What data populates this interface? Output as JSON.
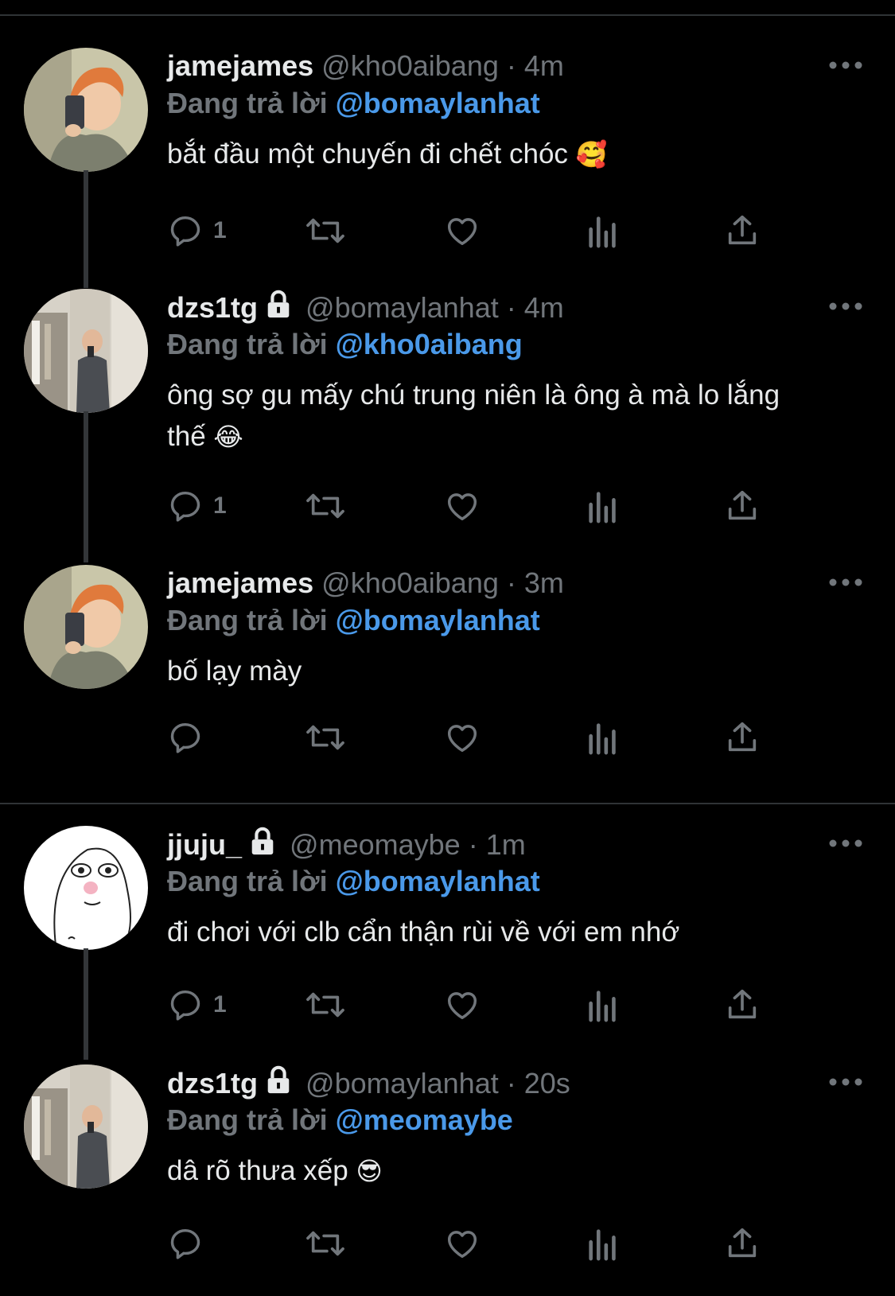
{
  "colors": {
    "background": "#000000",
    "text": "#e7e9ea",
    "muted": "#71767b",
    "mention": "#4a99e9",
    "divider": "#2f3336"
  },
  "reply_prefix": "Đang trả lời",
  "tweets": [
    {
      "name": "jamejames",
      "locked": false,
      "handle": "@kho0aibang",
      "dot": "·",
      "time": "4m",
      "reply_to": "@bomaylanhat",
      "text": "bắt đầu một chuyến đi chết chóc",
      "emoji": "🥰",
      "reply_count": "1",
      "avatar": "orange-hair-selfie"
    },
    {
      "name": "dzs1tg",
      "locked": true,
      "handle": "@bomaylanhat",
      "dot": "·",
      "time": "4m",
      "reply_to": "@kho0aibang",
      "text": "ông sợ gu mấy chú trung niên là ông à mà lo lắng thế",
      "emoji": "😂",
      "reply_count": "1",
      "avatar": "mirror-selfie"
    },
    {
      "name": "jamejames",
      "locked": false,
      "handle": "@kho0aibang",
      "dot": "·",
      "time": "3m",
      "reply_to": "@bomaylanhat",
      "text": "bố lạy mày",
      "emoji": "",
      "reply_count": "",
      "avatar": "orange-hair-selfie"
    },
    {
      "name": "jjuju_",
      "locked": true,
      "handle": "@meomaybe",
      "dot": "·",
      "time": "1m",
      "reply_to": "@bomaylanhat",
      "text": "đi chơi với clb cẩn thận rùi về với em nhớ",
      "emoji": "",
      "reply_count": "1",
      "avatar": "cartoon-face"
    },
    {
      "name": "dzs1tg",
      "locked": true,
      "handle": "@bomaylanhat",
      "dot": "·",
      "time": "20s",
      "reply_to": "@meomaybe",
      "text": "dâ rõ thưa xếp",
      "emoji": "😎",
      "reply_count": "",
      "avatar": "mirror-selfie"
    }
  ]
}
